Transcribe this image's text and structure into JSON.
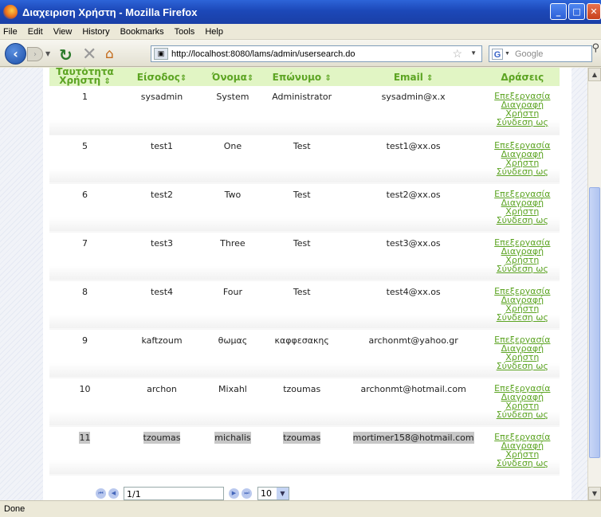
{
  "window": {
    "title": "Διαχειριση Χρήστη - Mozilla Firefox"
  },
  "menu": [
    "File",
    "Edit",
    "View",
    "History",
    "Bookmarks",
    "Tools",
    "Help"
  ],
  "nav": {
    "url": "http://localhost:8080/lams/admin/usersearch.do",
    "search_placeholder": "Google"
  },
  "table": {
    "headers": [
      "Ταυτότητα Χρήστη",
      "Είσοδος",
      "Όνομα",
      "Επώνυμο",
      "Email",
      "Δράσεις"
    ],
    "sort_glyph": "⇕",
    "rows": [
      [
        "1",
        "sysadmin",
        "System",
        "Administrator",
        "sysadmin@x.x"
      ],
      [
        "5",
        "test1",
        "One",
        "Test",
        "test1@xx.os"
      ],
      [
        "6",
        "test2",
        "Two",
        "Test",
        "test2@xx.os"
      ],
      [
        "7",
        "test3",
        "Three",
        "Test",
        "test3@xx.os"
      ],
      [
        "8",
        "test4",
        "Four",
        "Test",
        "test4@xx.os"
      ],
      [
        "9",
        "kaftzoum",
        "θωμας",
        "καφφεσακης",
        "archonmt@yahoo.gr"
      ],
      [
        "10",
        "archon",
        "Mixahl",
        "tzoumas",
        "archonmt@hotmail.com"
      ],
      [
        "11",
        "tzoumas",
        "michalis",
        "tzoumas",
        "mortimer158@hotmail.com"
      ]
    ],
    "selected_row_index": 7,
    "actions": [
      "Επεξεργασία",
      "Διαγραφή Χρήστη",
      "Σύνδεση ως"
    ]
  },
  "pager": {
    "page_text": "1/1",
    "page_size": "10"
  },
  "status": "Done",
  "colors": {
    "accent": "#5ca422",
    "header_bg": "#e1f5c4"
  }
}
